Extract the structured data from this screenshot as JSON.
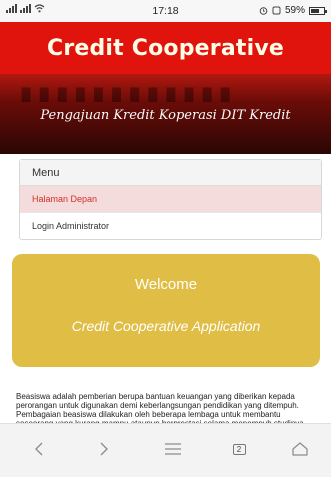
{
  "status_bar": {
    "carrier_left": "ฏil ฏil",
    "time": "17:18",
    "battery_percent": "59%"
  },
  "header": {
    "title": "Credit Cooperative"
  },
  "banner": {
    "subtitle": "Pengajuan Kredit Koperasi DIT Kredit"
  },
  "menu": {
    "heading": "Menu",
    "items": [
      {
        "label": "Halaman Depan",
        "active": true
      },
      {
        "label": "Login Administrator",
        "active": false
      }
    ]
  },
  "welcome": {
    "title": "Welcome",
    "subtitle": "Credit Cooperative Application"
  },
  "article": {
    "text": "Beasiswa adalah pemberian berupa bantuan keuangan yang diberikan kepada perorangan untuk digunakan demi keberlangsungan pendidikan yang ditempuh. Pembagaian beasiswa dilakukan oleh beberapa lembaga untuk membantu seseorang yang kurang mampu ataupun berprestasi selama menempuh studinya. Hal"
  },
  "nav_bar": {
    "tabs_count": "2",
    "icons": [
      "back-icon",
      "forward-icon",
      "menu-icon",
      "tabs-icon",
      "home-icon"
    ]
  },
  "colors": {
    "header_red": "#e0140c",
    "welcome_gold": "#e0bd44",
    "active_item_text": "#d2302a"
  }
}
